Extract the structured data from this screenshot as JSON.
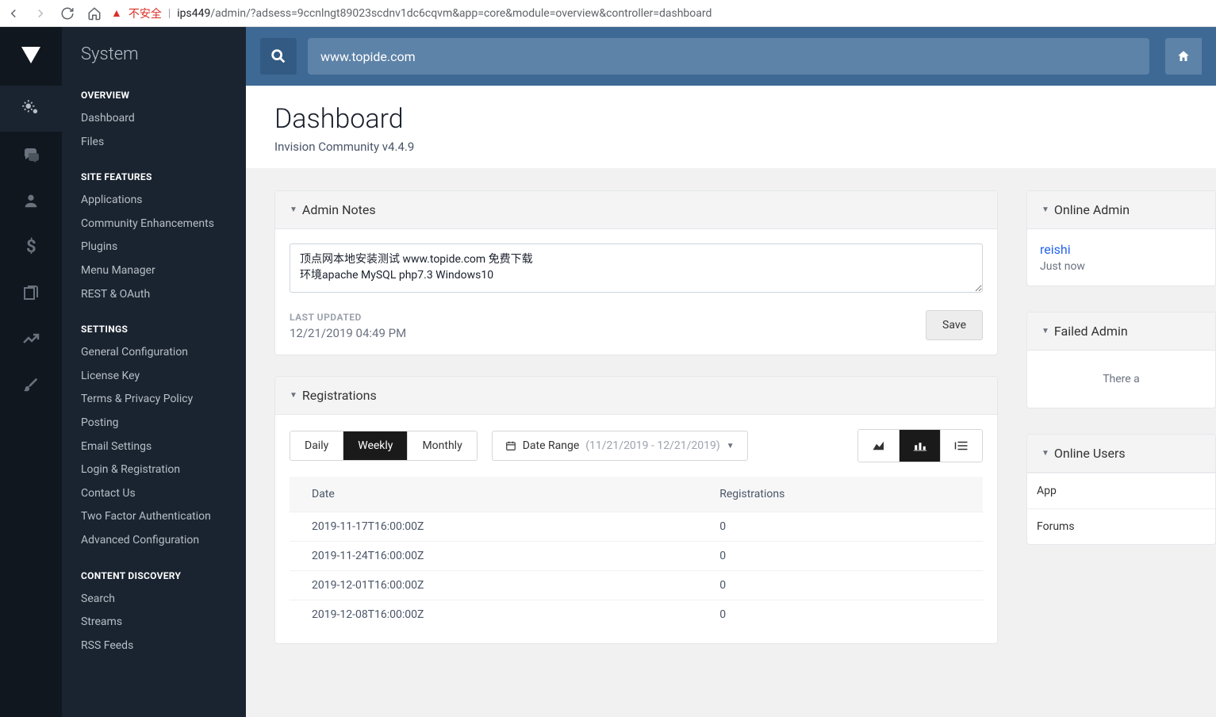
{
  "browser": {
    "security_label": "不安全",
    "url_host": "ips449",
    "url_path": "/admin/?adsess=9ccnlngt89023scdnv1dc6cqvm&app=core&module=overview&controller=dashboard"
  },
  "sidebar": {
    "title": "System",
    "sections": [
      {
        "heading": "OVERVIEW",
        "items": [
          "Dashboard",
          "Files"
        ]
      },
      {
        "heading": "SITE FEATURES",
        "items": [
          "Applications",
          "Community Enhancements",
          "Plugins",
          "Menu Manager",
          "REST & OAuth"
        ]
      },
      {
        "heading": "SETTINGS",
        "items": [
          "General Configuration",
          "License Key",
          "Terms & Privacy Policy",
          "Posting",
          "Email Settings",
          "Login & Registration",
          "Contact Us",
          "Two Factor Authentication",
          "Advanced Configuration"
        ]
      },
      {
        "heading": "CONTENT DISCOVERY",
        "items": [
          "Search",
          "Streams",
          "RSS Feeds"
        ]
      }
    ]
  },
  "topbar": {
    "search_placeholder": "www.topide.com"
  },
  "page": {
    "title": "Dashboard",
    "subtitle": "Invision Community v4.4.9"
  },
  "admin_notes": {
    "title": "Admin Notes",
    "value": "顶点网本地安装测试 www.topide.com 免费下载\n环境apache MySQL php7.3 Windows10",
    "last_updated_label": "LAST UPDATED",
    "last_updated_value": "12/21/2019 04:49 PM",
    "save_label": "Save"
  },
  "registrations": {
    "title": "Registrations",
    "tabs": {
      "daily": "Daily",
      "weekly": "Weekly",
      "monthly": "Monthly"
    },
    "date_range_label": "Date Range",
    "date_range_value": "(11/21/2019 - 12/21/2019)",
    "columns": {
      "date": "Date",
      "reg": "Registrations"
    },
    "rows": [
      {
        "date": "2019-11-17T16:00:00Z",
        "reg": "0"
      },
      {
        "date": "2019-11-24T16:00:00Z",
        "reg": "0"
      },
      {
        "date": "2019-12-01T16:00:00Z",
        "reg": "0"
      },
      {
        "date": "2019-12-08T16:00:00Z",
        "reg": "0"
      }
    ]
  },
  "online_admins": {
    "title": "Online Admin",
    "user": "reishi",
    "time": "Just now"
  },
  "failed_admin": {
    "title": "Failed Admin",
    "empty": "There a"
  },
  "online_users": {
    "title": "Online Users",
    "items": [
      "App",
      "Forums"
    ]
  },
  "chart_data": {
    "type": "table",
    "title": "Registrations (Weekly)",
    "xlabel": "Date",
    "ylabel": "Registrations",
    "categories": [
      "2019-11-17T16:00:00Z",
      "2019-11-24T16:00:00Z",
      "2019-12-01T16:00:00Z",
      "2019-12-08T16:00:00Z"
    ],
    "values": [
      0,
      0,
      0,
      0
    ],
    "range": "11/21/2019 - 12/21/2019"
  }
}
